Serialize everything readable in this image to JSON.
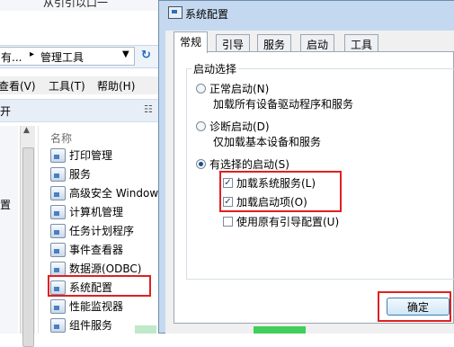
{
  "explorer": {
    "top_text": "从引引以口一",
    "address": {
      "crumb_prev": "有...",
      "crumb_current": "管理工具"
    },
    "menu": {
      "view": "查看(V)",
      "tools": "工具(T)",
      "help": "帮助(H)"
    },
    "toolbar": {
      "open": "开"
    },
    "nav_partial_item": "置",
    "column_name": "名称",
    "items": [
      {
        "label": "打印管理",
        "icon": "print-management-icon"
      },
      {
        "label": "服务",
        "icon": "services-icon"
      },
      {
        "label": "高级安全 Windows",
        "icon": "firewall-icon"
      },
      {
        "label": "计算机管理",
        "icon": "computer-management-icon"
      },
      {
        "label": "任务计划程序",
        "icon": "task-scheduler-icon"
      },
      {
        "label": "事件查看器",
        "icon": "event-viewer-icon"
      },
      {
        "label": "数据源(ODBC)",
        "icon": "odbc-icon"
      },
      {
        "label": "系统配置",
        "icon": "msconfig-icon",
        "highlighted": true
      },
      {
        "label": "性能监视器",
        "icon": "performance-monitor-icon"
      },
      {
        "label": "组件服务",
        "icon": "component-services-icon"
      }
    ]
  },
  "dialog": {
    "title": "系统配置",
    "tabs": [
      "常规",
      "引导",
      "服务",
      "启动",
      "工具"
    ],
    "active_tab": "常规",
    "group_title": "启动选择",
    "options": {
      "normal": {
        "label": "正常启动(N)",
        "desc": "加载所有设备驱动程序和服务",
        "selected": false
      },
      "diagnostic": {
        "label": "诊断启动(D)",
        "desc": "仅加载基本设备和服务",
        "selected": false
      },
      "selective": {
        "label": "有选择的启动(S)",
        "selected": true
      }
    },
    "checkboxes": {
      "load_services": {
        "label": "加载系统服务(L)",
        "checked": true
      },
      "load_startup": {
        "label": "加载启动项(O)",
        "checked": true
      },
      "use_original": {
        "label": "使用原有引导配置(U)",
        "checked": false
      }
    },
    "ok_button": "确定"
  },
  "colors": {
    "highlight_red": "#e02020",
    "dialog_frame": "#c4d9ef"
  }
}
